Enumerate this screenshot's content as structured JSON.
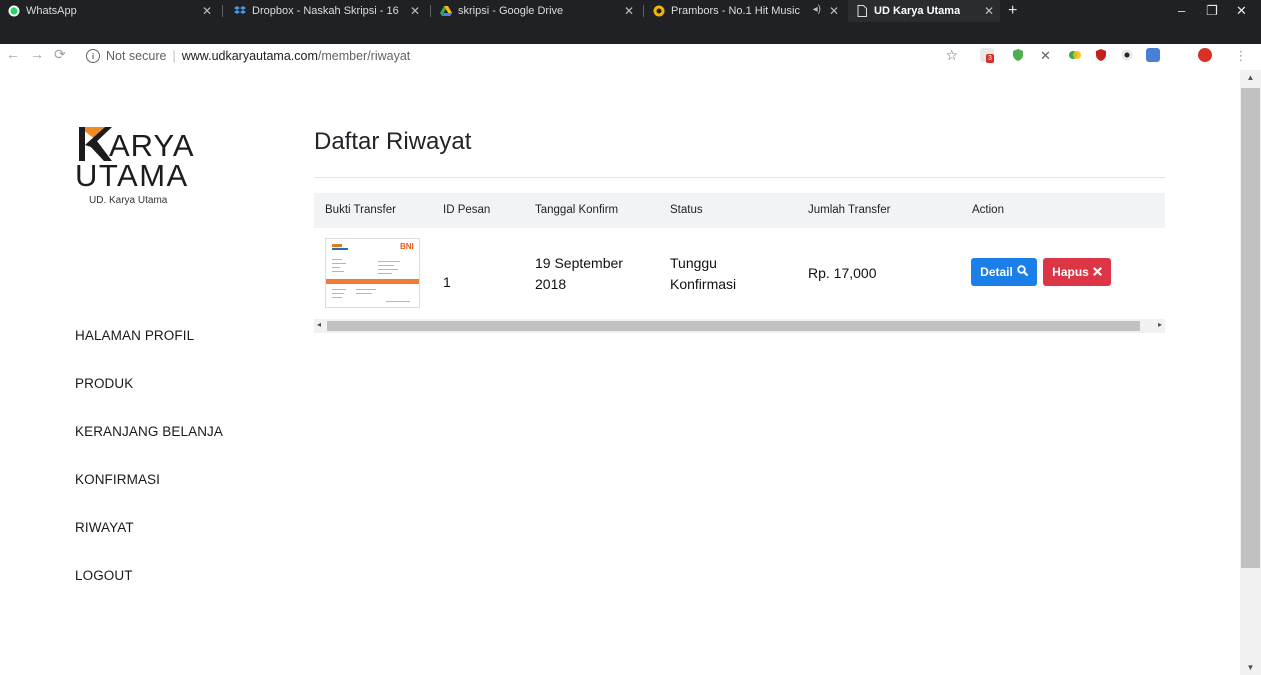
{
  "browser": {
    "tabs": [
      {
        "title": "WhatsApp",
        "icon": "whatsapp-icon"
      },
      {
        "title": "Dropbox - Naskah Skripsi - 16",
        "icon": "dropbox-icon"
      },
      {
        "title": "skripsi - Google Drive",
        "icon": "google-drive-icon"
      },
      {
        "title": "Prambors - No.1 Hit Music",
        "icon": "prambors-icon"
      },
      {
        "title": "UD Karya Utama",
        "icon": "page-icon",
        "active": true
      }
    ],
    "address": {
      "security": "Not secure",
      "host": "www.udkaryautama.com",
      "path": "/member/riwayat"
    },
    "extension_badge": "3"
  },
  "brand": {
    "logo_k": "K",
    "logo_line1": "ARYA",
    "logo_line2": "UTAMA",
    "subtitle": "UD. Karya Utama"
  },
  "sidebar": {
    "items": [
      {
        "label": "HALAMAN PROFIL"
      },
      {
        "label": "PRODUK"
      },
      {
        "label": "KERANJANG BELANJA"
      },
      {
        "label": "KONFIRMASI"
      },
      {
        "label": "RIWAYAT"
      },
      {
        "label": "LOGOUT"
      }
    ]
  },
  "main": {
    "title": "Daftar Riwayat",
    "table": {
      "columns": [
        "Bukti Transfer",
        "ID Pesan",
        "Tanggal Konfirm",
        "Status",
        "Jumlah Transfer",
        "Action"
      ],
      "rows": [
        {
          "id_pesan": "1",
          "tanggal_line1": "19 September",
          "tanggal_line2": "2018",
          "status_line1": "Tunggu",
          "status_line2": "Konfirmasi",
          "jumlah": "Rp. 17,000",
          "detail_label": "Detail",
          "hapus_label": "Hapus",
          "receipt_bank": "BNI"
        }
      ]
    }
  },
  "colors": {
    "detail_button": "#1a7fe8",
    "hapus_button": "#dc3545",
    "logo_orange": "#f08a24"
  }
}
